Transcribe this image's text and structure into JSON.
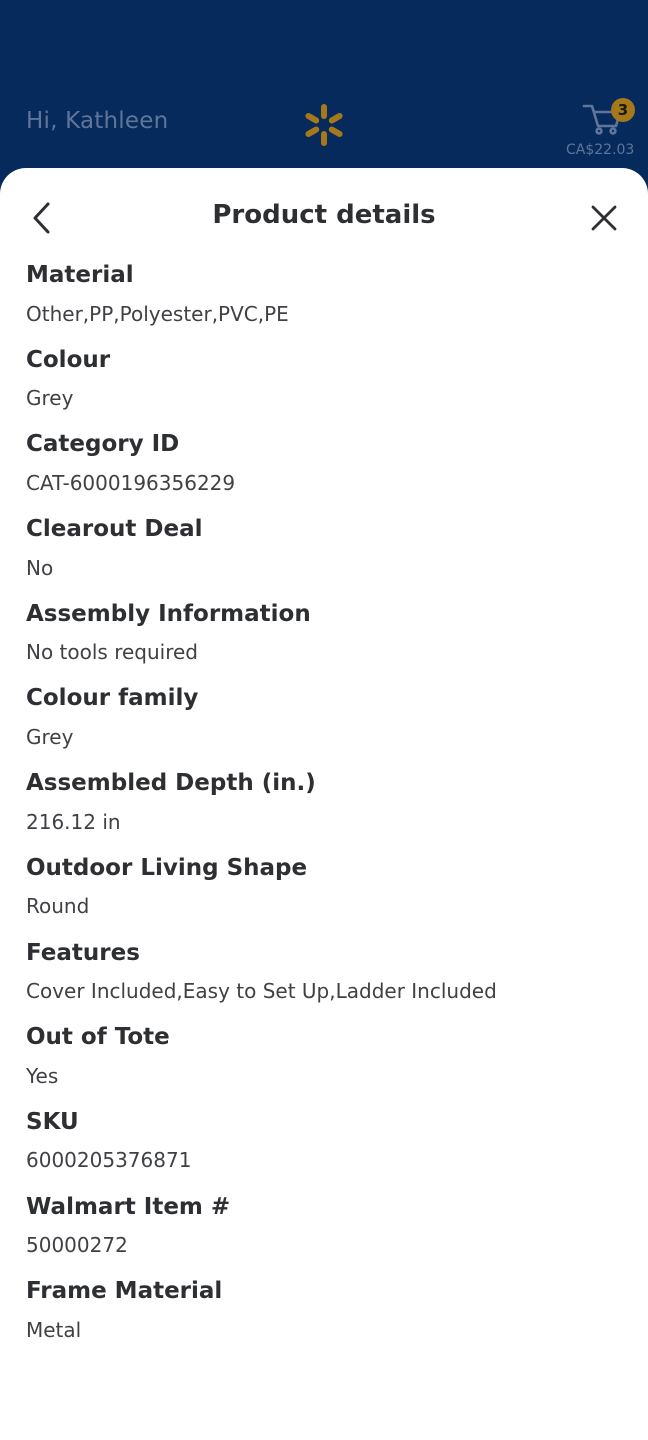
{
  "header": {
    "greeting": "Hi, Kathleen",
    "cart_count": "3",
    "cart_total": "CA$22.03"
  },
  "sheet": {
    "title": "Product details"
  },
  "details": [
    {
      "label": "Material",
      "value": "Other,PP,Polyester,PVC,PE"
    },
    {
      "label": "Colour",
      "value": "Grey"
    },
    {
      "label": "Category ID",
      "value": "CAT-6000196356229"
    },
    {
      "label": "Clearout Deal",
      "value": "No"
    },
    {
      "label": "Assembly Information",
      "value": "No tools required"
    },
    {
      "label": "Colour family",
      "value": "Grey"
    },
    {
      "label": "Assembled Depth (in.)",
      "value": "216.12 in"
    },
    {
      "label": "Outdoor Living Shape",
      "value": "Round"
    },
    {
      "label": "Features",
      "value": "Cover Included,Easy to Set Up,Ladder Included"
    },
    {
      "label": "Out of Tote",
      "value": "Yes"
    },
    {
      "label": "SKU",
      "value": "6000205376871"
    },
    {
      "label": "Walmart Item #",
      "value": "50000272"
    },
    {
      "label": "Frame Material",
      "value": "Metal"
    }
  ],
  "icons": {
    "back": "chevron-left-icon",
    "close": "close-icon",
    "cart": "cart-icon",
    "logo": "walmart-spark-icon"
  },
  "colors": {
    "header_bg": "#062a5c",
    "spark": "#a5791a",
    "badge": "#a5791a"
  }
}
